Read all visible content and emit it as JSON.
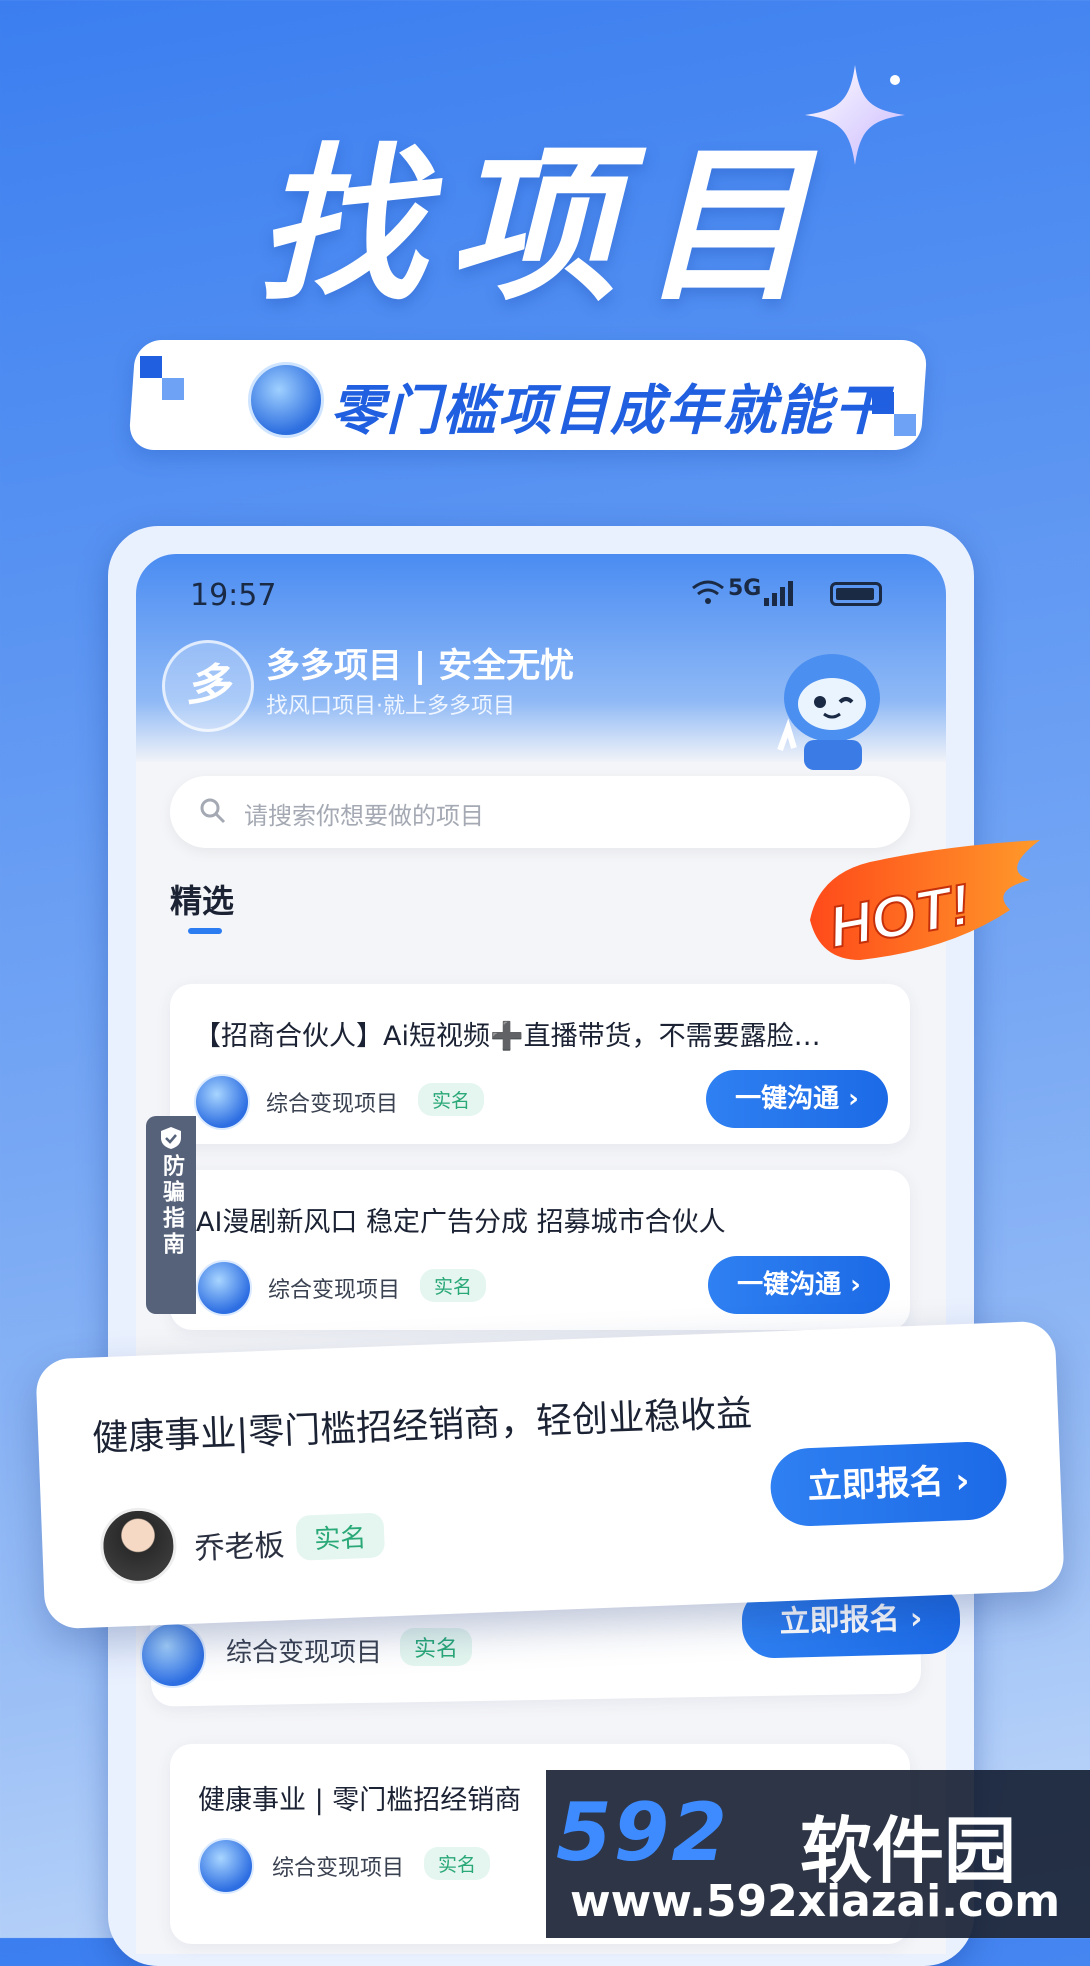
{
  "hero": {
    "title": "找项目",
    "slogan": "零门槛项目成年就能干"
  },
  "phone": {
    "status_time": "19:57",
    "status_network": "5G",
    "brand_logo_char": "多",
    "brand_title": "多多项目 | 安全无忧",
    "brand_subtitle": "找风口项目·就上多多项目",
    "search_placeholder": "请搜索你想要做的项目",
    "tab_featured": "精选",
    "hot_badge": "HOT!"
  },
  "fraud_guide": {
    "label": "防骗指南"
  },
  "cards": [
    {
      "title": "【招商合伙人】Ai短视频➕直播带货，不需要露脸…",
      "category": "综合变现项目",
      "verified": "实名",
      "button": "一键沟通 ›"
    },
    {
      "title": "AI漫剧新风口 稳定广告分成 招募城市合伙人",
      "category": "综合变现项目",
      "verified": "实名",
      "button": "一键沟通 ›"
    },
    {
      "title": "",
      "category": "综合变现项目",
      "verified": "实名",
      "button": "立即报名 ›"
    },
    {
      "title": "健康事业 | 零门槛招经销商",
      "category": "综合变现项目",
      "verified": "实名",
      "button": ""
    }
  ],
  "featured_card": {
    "title": "健康事业|零门槛招经销商，轻创业稳收益",
    "owner": "乔老板",
    "verified": "实名",
    "button": "立即报名 ›"
  },
  "watermark": {
    "brand_num": "592",
    "brand_text": "软件园",
    "url": "www.592xiazai.com"
  },
  "colors": {
    "accent": "#2a7cf0",
    "verified_green": "#2aa878",
    "background_top": "#3b7ef0"
  }
}
